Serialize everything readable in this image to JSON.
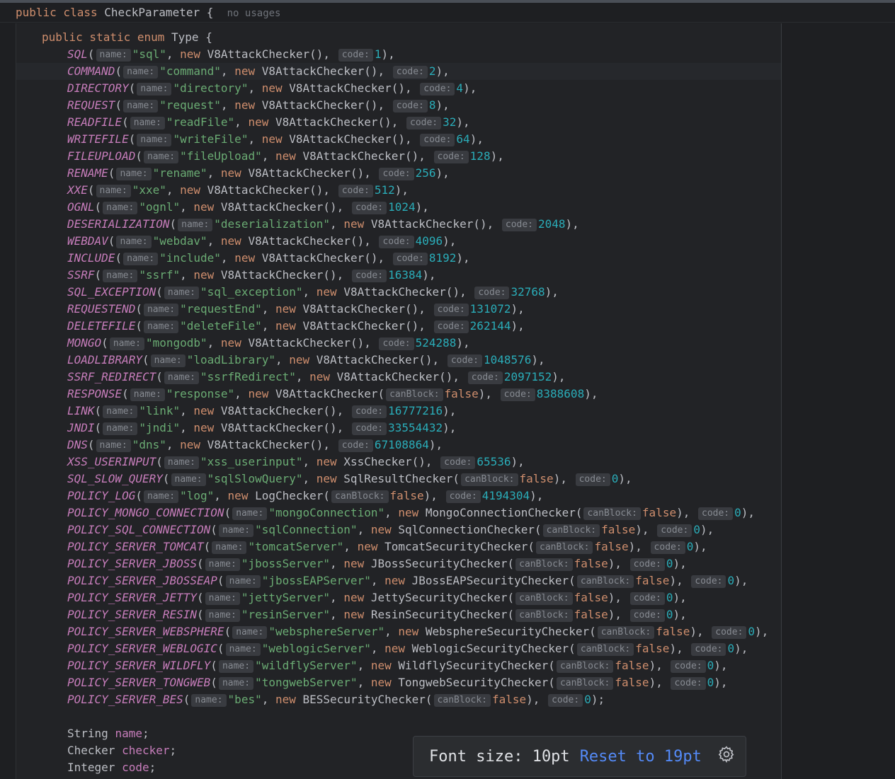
{
  "header": {
    "text": "public class CheckParameter {",
    "usages": "no usages"
  },
  "enum_decl": {
    "modifiers": "public static enum",
    "name": "Type"
  },
  "enum_entries": [
    {
      "name": "SQL",
      "args": [
        [
          "name",
          "\"sql\"",
          "str"
        ],
        [
          null,
          "new V8AttackChecker()",
          "ctor"
        ],
        [
          "code",
          "1",
          "num"
        ]
      ]
    },
    {
      "name": "COMMAND",
      "args": [
        [
          "name",
          "\"command\"",
          "str"
        ],
        [
          null,
          "new V8AttackChecker()",
          "ctor"
        ],
        [
          "code",
          "2",
          "num"
        ]
      ]
    },
    {
      "name": "DIRECTORY",
      "args": [
        [
          "name",
          "\"directory\"",
          "str"
        ],
        [
          null,
          "new V8AttackChecker()",
          "ctor"
        ],
        [
          "code",
          "4",
          "num"
        ]
      ]
    },
    {
      "name": "REQUEST",
      "args": [
        [
          "name",
          "\"request\"",
          "str"
        ],
        [
          null,
          "new V8AttackChecker()",
          "ctor"
        ],
        [
          "code",
          "8",
          "num"
        ]
      ]
    },
    {
      "name": "READFILE",
      "args": [
        [
          "name",
          "\"readFile\"",
          "str"
        ],
        [
          null,
          "new V8AttackChecker()",
          "ctor"
        ],
        [
          "code",
          "32",
          "num"
        ]
      ]
    },
    {
      "name": "WRITEFILE",
      "args": [
        [
          "name",
          "\"writeFile\"",
          "str"
        ],
        [
          null,
          "new V8AttackChecker()",
          "ctor"
        ],
        [
          "code",
          "64",
          "num"
        ]
      ]
    },
    {
      "name": "FILEUPLOAD",
      "args": [
        [
          "name",
          "\"fileUpload\"",
          "str"
        ],
        [
          null,
          "new V8AttackChecker()",
          "ctor"
        ],
        [
          "code",
          "128",
          "num"
        ]
      ]
    },
    {
      "name": "RENAME",
      "args": [
        [
          "name",
          "\"rename\"",
          "str"
        ],
        [
          null,
          "new V8AttackChecker()",
          "ctor"
        ],
        [
          "code",
          "256",
          "num"
        ]
      ]
    },
    {
      "name": "XXE",
      "args": [
        [
          "name",
          "\"xxe\"",
          "str"
        ],
        [
          null,
          "new V8AttackChecker()",
          "ctor"
        ],
        [
          "code",
          "512",
          "num"
        ]
      ]
    },
    {
      "name": "OGNL",
      "args": [
        [
          "name",
          "\"ognl\"",
          "str"
        ],
        [
          null,
          "new V8AttackChecker()",
          "ctor"
        ],
        [
          "code",
          "1024",
          "num"
        ]
      ]
    },
    {
      "name": "DESERIALIZATION",
      "args": [
        [
          "name",
          "\"deserialization\"",
          "str"
        ],
        [
          null,
          "new V8AttackChecker()",
          "ctor"
        ],
        [
          "code",
          "2048",
          "num"
        ]
      ]
    },
    {
      "name": "WEBDAV",
      "args": [
        [
          "name",
          "\"webdav\"",
          "str"
        ],
        [
          null,
          "new V8AttackChecker()",
          "ctor"
        ],
        [
          "code",
          "4096",
          "num"
        ]
      ]
    },
    {
      "name": "INCLUDE",
      "args": [
        [
          "name",
          "\"include\"",
          "str"
        ],
        [
          null,
          "new V8AttackChecker()",
          "ctor"
        ],
        [
          "code",
          "8192",
          "num"
        ]
      ]
    },
    {
      "name": "SSRF",
      "args": [
        [
          "name",
          "\"ssrf\"",
          "str"
        ],
        [
          null,
          "new V8AttackChecker()",
          "ctor"
        ],
        [
          "code",
          "16384",
          "num"
        ]
      ]
    },
    {
      "name": "SQL_EXCEPTION",
      "args": [
        [
          "name",
          "\"sql_exception\"",
          "str"
        ],
        [
          null,
          "new V8AttackChecker()",
          "ctor"
        ],
        [
          "code",
          "32768",
          "num"
        ]
      ]
    },
    {
      "name": "REQUESTEND",
      "args": [
        [
          "name",
          "\"requestEnd\"",
          "str"
        ],
        [
          null,
          "new V8AttackChecker()",
          "ctor"
        ],
        [
          "code",
          "131072",
          "num"
        ]
      ]
    },
    {
      "name": "DELETEFILE",
      "args": [
        [
          "name",
          "\"deleteFile\"",
          "str"
        ],
        [
          null,
          "new V8AttackChecker()",
          "ctor"
        ],
        [
          "code",
          "262144",
          "num"
        ]
      ]
    },
    {
      "name": "MONGO",
      "args": [
        [
          "name",
          "\"mongodb\"",
          "str"
        ],
        [
          null,
          "new V8AttackChecker()",
          "ctor"
        ],
        [
          "code",
          "524288",
          "num"
        ]
      ]
    },
    {
      "name": "LOADLIBRARY",
      "args": [
        [
          "name",
          "\"loadLibrary\"",
          "str"
        ],
        [
          null,
          "new V8AttackChecker()",
          "ctor"
        ],
        [
          "code",
          "1048576",
          "num"
        ]
      ]
    },
    {
      "name": "SSRF_REDIRECT",
      "args": [
        [
          "name",
          "\"ssrfRedirect\"",
          "str"
        ],
        [
          null,
          "new V8AttackChecker()",
          "ctor"
        ],
        [
          "code",
          "2097152",
          "num"
        ]
      ]
    },
    {
      "name": "RESPONSE",
      "args": [
        [
          "name",
          "\"response\"",
          "str"
        ],
        [
          null,
          "new V8AttackChecker(",
          "open"
        ],
        [
          "canBlock",
          "false",
          "kwend"
        ],
        [
          "code",
          "8388608",
          "num"
        ]
      ]
    },
    {
      "name": "LINK",
      "args": [
        [
          "name",
          "\"link\"",
          "str"
        ],
        [
          null,
          "new V8AttackChecker()",
          "ctor"
        ],
        [
          "code",
          "16777216",
          "num"
        ]
      ]
    },
    {
      "name": "JNDI",
      "args": [
        [
          "name",
          "\"jndi\"",
          "str"
        ],
        [
          null,
          "new V8AttackChecker()",
          "ctor"
        ],
        [
          "code",
          "33554432",
          "num"
        ]
      ]
    },
    {
      "name": "DNS",
      "args": [
        [
          "name",
          "\"dns\"",
          "str"
        ],
        [
          null,
          "new V8AttackChecker()",
          "ctor"
        ],
        [
          "code",
          "67108864",
          "num"
        ]
      ]
    },
    {
      "name": "XSS_USERINPUT",
      "args": [
        [
          "name",
          "\"xss_userinput\"",
          "str"
        ],
        [
          null,
          "new XssChecker()",
          "ctor"
        ],
        [
          "code",
          "65536",
          "num"
        ]
      ]
    },
    {
      "name": "SQL_SLOW_QUERY",
      "args": [
        [
          "name",
          "\"sqlSlowQuery\"",
          "str"
        ],
        [
          null,
          "new SqlResultChecker(",
          "open"
        ],
        [
          "canBlock",
          "false",
          "kwend"
        ],
        [
          "code",
          "0",
          "num"
        ]
      ]
    },
    {
      "name": "POLICY_LOG",
      "args": [
        [
          "name",
          "\"log\"",
          "str"
        ],
        [
          null,
          "new LogChecker(",
          "open"
        ],
        [
          "canBlock",
          "false",
          "kwend"
        ],
        [
          "code",
          "4194304",
          "num"
        ]
      ]
    },
    {
      "name": "POLICY_MONGO_CONNECTION",
      "args": [
        [
          "name",
          "\"mongoConnection\"",
          "str"
        ],
        [
          null,
          "new MongoConnectionChecker(",
          "open"
        ],
        [
          "canBlock",
          "false",
          "kwend"
        ],
        [
          "code",
          "0",
          "num"
        ]
      ]
    },
    {
      "name": "POLICY_SQL_CONNECTION",
      "args": [
        [
          "name",
          "\"sqlConnection\"",
          "str"
        ],
        [
          null,
          "new SqlConnectionChecker(",
          "open"
        ],
        [
          "canBlock",
          "false",
          "kwend"
        ],
        [
          "code",
          "0",
          "num"
        ]
      ]
    },
    {
      "name": "POLICY_SERVER_TOMCAT",
      "args": [
        [
          "name",
          "\"tomcatServer\"",
          "str"
        ],
        [
          null,
          "new TomcatSecurityChecker(",
          "open"
        ],
        [
          "canBlock",
          "false",
          "kwend"
        ],
        [
          "code",
          "0",
          "num"
        ]
      ]
    },
    {
      "name": "POLICY_SERVER_JBOSS",
      "args": [
        [
          "name",
          "\"jbossServer\"",
          "str"
        ],
        [
          null,
          "new JBossSecurityChecker(",
          "open"
        ],
        [
          "canBlock",
          "false",
          "kwend"
        ],
        [
          "code",
          "0",
          "num"
        ]
      ]
    },
    {
      "name": "POLICY_SERVER_JBOSSEAP",
      "args": [
        [
          "name",
          "\"jbossEAPServer\"",
          "str"
        ],
        [
          null,
          "new JBossEAPSecurityChecker(",
          "open"
        ],
        [
          "canBlock",
          "false",
          "kwend"
        ],
        [
          "code",
          "0",
          "num"
        ]
      ]
    },
    {
      "name": "POLICY_SERVER_JETTY",
      "args": [
        [
          "name",
          "\"jettyServer\"",
          "str"
        ],
        [
          null,
          "new JettySecurityChecker(",
          "open"
        ],
        [
          "canBlock",
          "false",
          "kwend"
        ],
        [
          "code",
          "0",
          "num"
        ]
      ]
    },
    {
      "name": "POLICY_SERVER_RESIN",
      "args": [
        [
          "name",
          "\"resinServer\"",
          "str"
        ],
        [
          null,
          "new ResinSecurityChecker(",
          "open"
        ],
        [
          "canBlock",
          "false",
          "kwend"
        ],
        [
          "code",
          "0",
          "num"
        ]
      ]
    },
    {
      "name": "POLICY_SERVER_WEBSPHERE",
      "args": [
        [
          "name",
          "\"websphereServer\"",
          "str"
        ],
        [
          null,
          "new WebsphereSecurityChecker(",
          "open"
        ],
        [
          "canBlock",
          "false",
          "kwend"
        ],
        [
          "code",
          "0",
          "num"
        ]
      ]
    },
    {
      "name": "POLICY_SERVER_WEBLOGIC",
      "args": [
        [
          "name",
          "\"weblogicServer\"",
          "str"
        ],
        [
          null,
          "new WeblogicSecurityChecker(",
          "open"
        ],
        [
          "canBlock",
          "false",
          "kwend"
        ],
        [
          "code",
          "0",
          "num"
        ]
      ]
    },
    {
      "name": "POLICY_SERVER_WILDFLY",
      "args": [
        [
          "name",
          "\"wildflyServer\"",
          "str"
        ],
        [
          null,
          "new WildflySecurityChecker(",
          "open"
        ],
        [
          "canBlock",
          "false",
          "kwend"
        ],
        [
          "code",
          "0",
          "num"
        ]
      ]
    },
    {
      "name": "POLICY_SERVER_TONGWEB",
      "args": [
        [
          "name",
          "\"tongwebServer\"",
          "str"
        ],
        [
          null,
          "new TongwebSecurityChecker(",
          "open"
        ],
        [
          "canBlock",
          "false",
          "kwend"
        ],
        [
          "code",
          "0",
          "num"
        ]
      ]
    },
    {
      "name": "POLICY_SERVER_BES",
      "args": [
        [
          "name",
          "\"bes\"",
          "str"
        ],
        [
          null,
          "new BESSecurityChecker(",
          "open"
        ],
        [
          "canBlock",
          "false",
          "kwend"
        ],
        [
          "code",
          "0",
          "num"
        ]
      ]
    }
  ],
  "fields": [
    {
      "type": "String",
      "name": "name"
    },
    {
      "type": "Checker",
      "name": "checker"
    },
    {
      "type": "Integer",
      "name": "code"
    }
  ],
  "font_toast": {
    "label": "Font size: 10pt",
    "reset": "Reset to 19pt",
    "icon": "gear-icon"
  }
}
